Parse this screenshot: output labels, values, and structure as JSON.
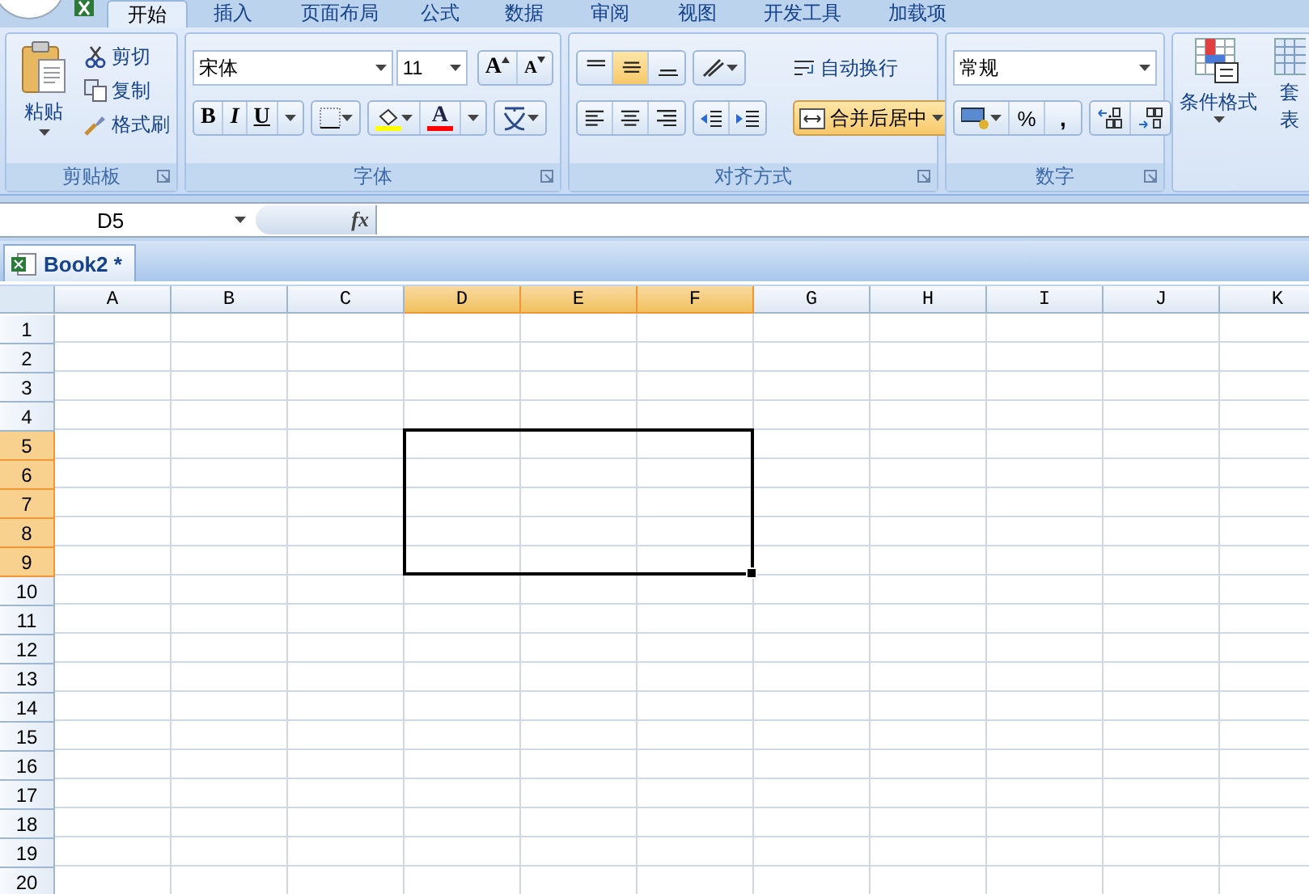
{
  "tabs": [
    {
      "label": "开始",
      "selected": true
    },
    {
      "label": "插入",
      "selected": false
    },
    {
      "label": "页面布局",
      "selected": false
    },
    {
      "label": "公式",
      "selected": false
    },
    {
      "label": "数据",
      "selected": false
    },
    {
      "label": "审阅",
      "selected": false
    },
    {
      "label": "视图",
      "selected": false
    },
    {
      "label": "开发工具",
      "selected": false
    },
    {
      "label": "加载项",
      "selected": false
    }
  ],
  "clipboard": {
    "title": "剪贴板",
    "paste": "粘贴",
    "items": [
      {
        "kind": "cut",
        "label": "剪切"
      },
      {
        "kind": "copy",
        "label": "复制"
      },
      {
        "kind": "painter",
        "label": "格式刷"
      }
    ]
  },
  "font": {
    "title": "字体",
    "font_name": "宋体",
    "font_size": "11",
    "grow": "A",
    "shrink": "A",
    "styles": [
      {
        "label": "B",
        "kind": "bold"
      },
      {
        "label": "I",
        "kind": "italic"
      },
      {
        "label": "U",
        "kind": "underline"
      }
    ],
    "text_color_label": "A"
  },
  "alignment": {
    "title": "对齐方式",
    "vertical": [
      {
        "kind": "top",
        "selected": false
      },
      {
        "kind": "middle",
        "selected": true
      },
      {
        "kind": "bottom",
        "selected": false
      }
    ],
    "horizontal": [
      {
        "kind": "left",
        "selected": false
      },
      {
        "kind": "center",
        "selected": false
      },
      {
        "kind": "right",
        "selected": false
      }
    ],
    "wrap_text": "自动换行",
    "merge": {
      "label": "合并后居中",
      "on": true
    }
  },
  "number": {
    "title": "数字",
    "format": "常规",
    "percent": "%",
    "comma": ","
  },
  "styles": {
    "conditional": "条件格式",
    "table_line1": "套",
    "table_line2": "表"
  },
  "formula_bar": {
    "name_box": "D5",
    "fx": "fx"
  },
  "workbook_tab": {
    "label": "Book2 *"
  },
  "sheet": {
    "columns": [
      {
        "label": "A",
        "selected": false
      },
      {
        "label": "B",
        "selected": false
      },
      {
        "label": "C",
        "selected": false
      },
      {
        "label": "D",
        "selected": true
      },
      {
        "label": "E",
        "selected": true
      },
      {
        "label": "F",
        "selected": true
      },
      {
        "label": "G",
        "selected": false
      },
      {
        "label": "H",
        "selected": false
      },
      {
        "label": "I",
        "selected": false
      },
      {
        "label": "J",
        "selected": false
      },
      {
        "label": "K",
        "selected": false
      }
    ],
    "rows": [
      {
        "label": "1",
        "selected": false
      },
      {
        "label": "2",
        "selected": false
      },
      {
        "label": "3",
        "selected": false
      },
      {
        "label": "4",
        "selected": false
      },
      {
        "label": "5",
        "selected": true
      },
      {
        "label": "6",
        "selected": true
      },
      {
        "label": "7",
        "selected": true
      },
      {
        "label": "8",
        "selected": true
      },
      {
        "label": "9",
        "selected": true
      },
      {
        "label": "10",
        "selected": false
      },
      {
        "label": "11",
        "selected": false
      },
      {
        "label": "12",
        "selected": false
      },
      {
        "label": "13",
        "selected": false
      },
      {
        "label": "14",
        "selected": false
      },
      {
        "label": "15",
        "selected": false
      },
      {
        "label": "16",
        "selected": false
      },
      {
        "label": "17",
        "selected": false
      },
      {
        "label": "18",
        "selected": false
      },
      {
        "label": "19",
        "selected": false
      },
      {
        "label": "20",
        "selected": false
      }
    ]
  }
}
